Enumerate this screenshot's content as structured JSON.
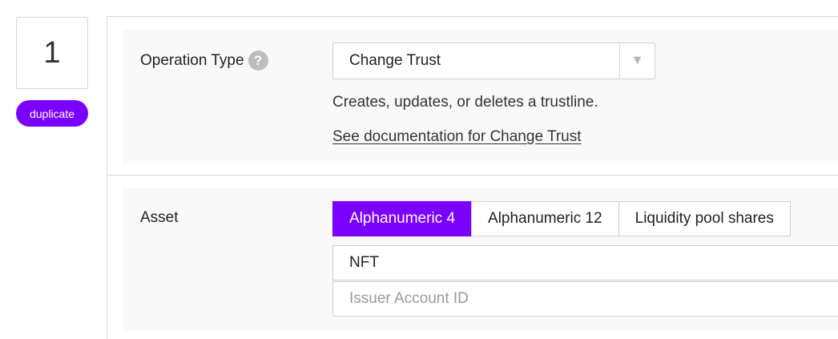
{
  "operation": {
    "number": "1",
    "duplicate_label": "duplicate"
  },
  "operation_type": {
    "label": "Operation Type",
    "help_icon": "?",
    "selected": "Change Trust",
    "arrow": "▼",
    "description": "Creates, updates, or deletes a trustline.",
    "doc_link": "See documentation for Change Trust"
  },
  "asset": {
    "label": "Asset",
    "tabs": [
      {
        "label": "Alphanumeric 4",
        "active": true
      },
      {
        "label": "Alphanumeric 12",
        "active": false
      },
      {
        "label": "Liquidity pool shares",
        "active": false
      }
    ],
    "code_value": "NFT",
    "issuer_placeholder": "Issuer Account ID"
  },
  "colors": {
    "accent": "#7a00ff"
  }
}
